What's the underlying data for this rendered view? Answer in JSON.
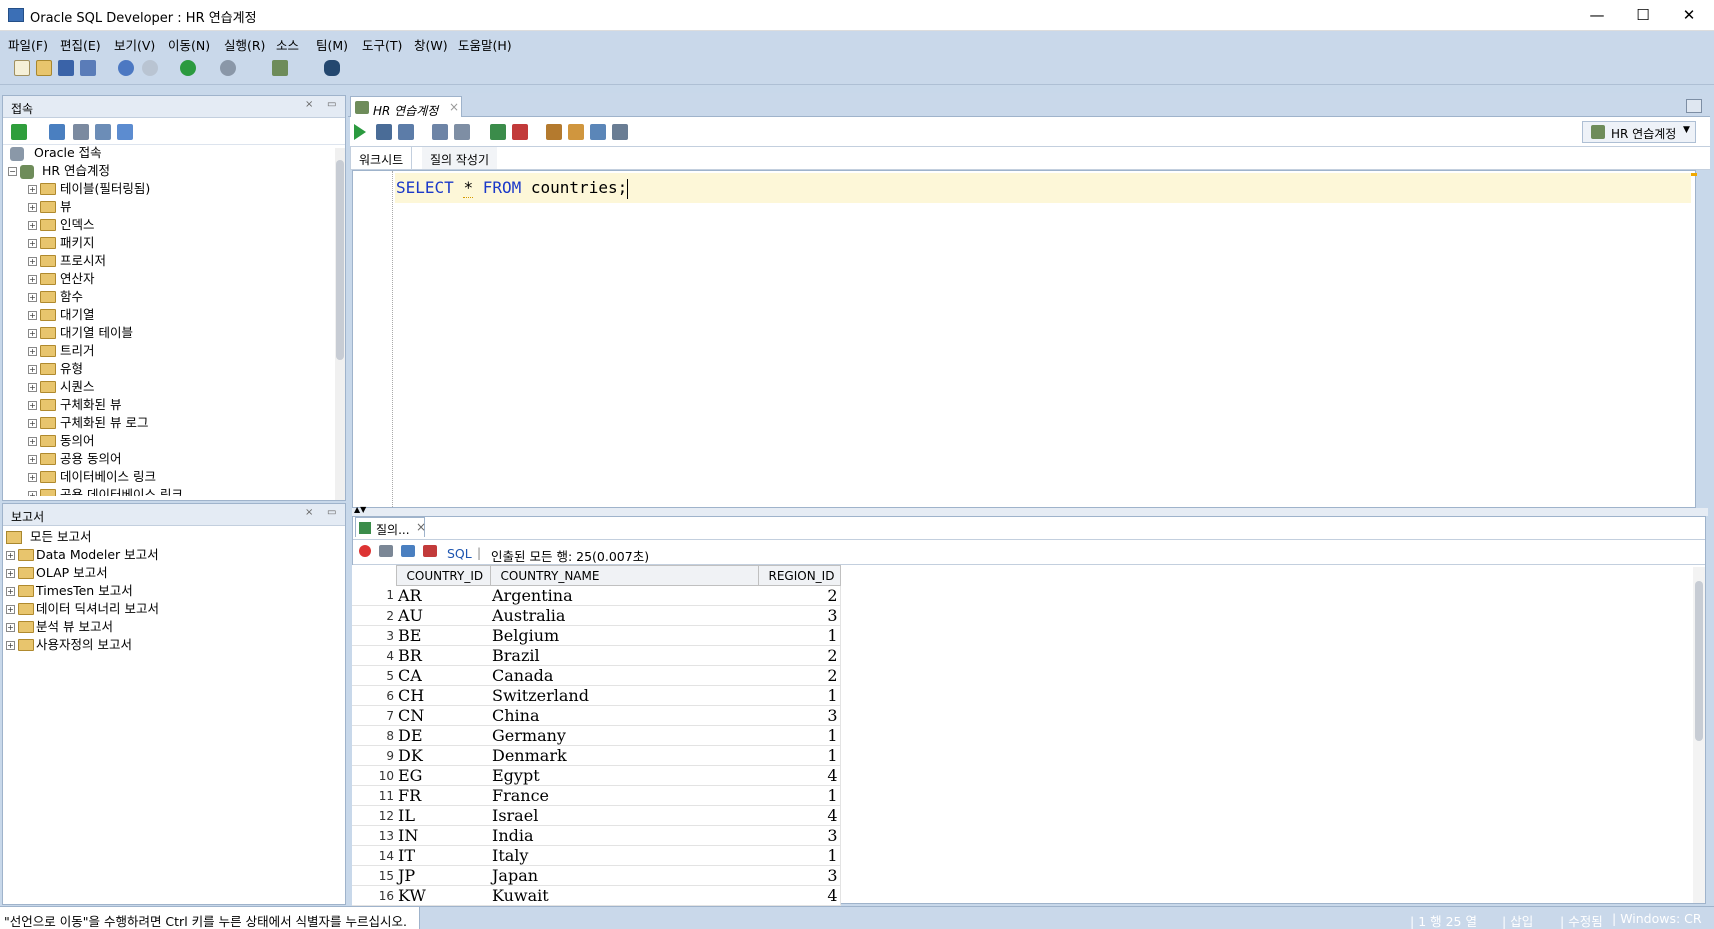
{
  "window": {
    "title": "Oracle SQL Developer : HR 연습계정",
    "minimize": "—",
    "maximize": "☐",
    "close": "✕"
  },
  "menu": [
    "파일(F)",
    "편집(E)",
    "보기(V)",
    "이동(N)",
    "실행(R)",
    "소스",
    "팀(M)",
    "도구(T)",
    "창(W)",
    "도움말(H)"
  ],
  "connections_panel": {
    "title": "접속",
    "root": "Oracle 접속",
    "connection": "HR 연습계정",
    "nodes": [
      "테이블(필터링됨)",
      "뷰",
      "인덱스",
      "패키지",
      "프로시저",
      "연산자",
      "함수",
      "대기열",
      "대기열 테이블",
      "트리거",
      "유형",
      "시퀀스",
      "구체화된 뷰",
      "구체화된 뷰 로그",
      "동의어",
      "공용 동의어",
      "데이터베이스 링크",
      "공용 데이터베이스 링크"
    ]
  },
  "reports_panel": {
    "title": "보고서",
    "root": "모든 보고서",
    "nodes": [
      "Data Modeler 보고서",
      "OLAP 보고서",
      "TimesTen 보고서",
      "데이터 딕셔너리 보고서",
      "분석 뷰 보고서",
      "사용자정의 보고서"
    ]
  },
  "editor": {
    "tab_label": "HR 연습계정",
    "connection_selector": "HR 연습계정",
    "subtabs": [
      "워크시트",
      "질의 작성기"
    ],
    "sql": {
      "kw1": "SELECT",
      "star": "*",
      "kw2": "FROM",
      "rest": "countries;"
    }
  },
  "results": {
    "tab_label": "질의...",
    "sql_link": "SQL",
    "status": "인출된 모든 행: 25(0.007초)",
    "columns": [
      "COUNTRY_ID",
      "COUNTRY_NAME",
      "REGION_ID"
    ],
    "rows": [
      [
        "1",
        "AR",
        "Argentina",
        "2"
      ],
      [
        "2",
        "AU",
        "Australia",
        "3"
      ],
      [
        "3",
        "BE",
        "Belgium",
        "1"
      ],
      [
        "4",
        "BR",
        "Brazil",
        "2"
      ],
      [
        "5",
        "CA",
        "Canada",
        "2"
      ],
      [
        "6",
        "CH",
        "Switzerland",
        "1"
      ],
      [
        "7",
        "CN",
        "China",
        "3"
      ],
      [
        "8",
        "DE",
        "Germany",
        "1"
      ],
      [
        "9",
        "DK",
        "Denmark",
        "1"
      ],
      [
        "10",
        "EG",
        "Egypt",
        "4"
      ],
      [
        "11",
        "FR",
        "France",
        "1"
      ],
      [
        "12",
        "IL",
        "Israel",
        "4"
      ],
      [
        "13",
        "IN",
        "India",
        "3"
      ],
      [
        "14",
        "IT",
        "Italy",
        "1"
      ],
      [
        "15",
        "JP",
        "Japan",
        "3"
      ],
      [
        "16",
        "KW",
        "Kuwait",
        "4"
      ]
    ]
  },
  "statusbar": {
    "message": "\"선언으로 이동\"을 수행하려면 Ctrl 키를 누른 상태에서 식별자를 누르십시오.",
    "position": "1 행 25 열",
    "mode": "삽입",
    "modified": "수정됨",
    "os": "Windows: CR"
  },
  "colors": {
    "keyword": "#1b39c9",
    "chrome": "#c9d8ea",
    "current_line": "#fdf7d8"
  }
}
